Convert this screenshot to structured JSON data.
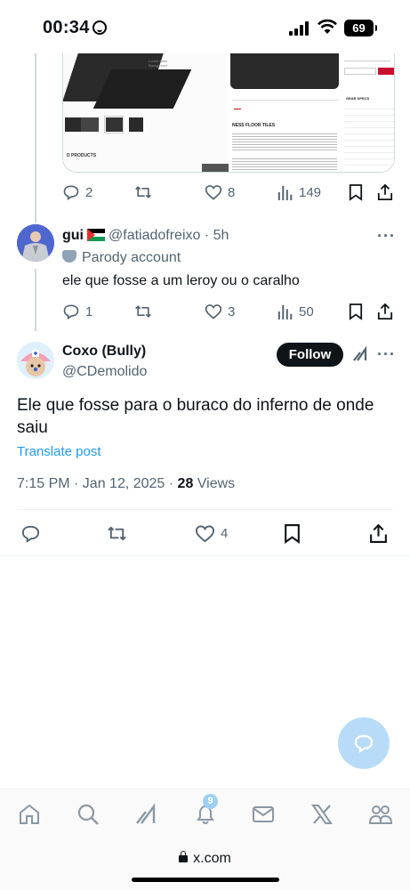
{
  "status_bar": {
    "time": "00:34",
    "battery": "69"
  },
  "previous_tweet_actions": {
    "replies": "2",
    "likes": "8",
    "views": "149"
  },
  "media_card": {
    "heading": "NESS FLOOR TILES",
    "specs_title": "GEAR SPECS",
    "specs": [
      {
        "k": "Brand",
        "v": "GravityRes"
      },
      {
        "k": "Color",
        "v": "Black"
      },
      {
        "k": "Made in USA",
        "v": "No"
      },
      {
        "k": "Product Weight",
        "v": "2.950 LBS"
      },
      {
        "k": "Length",
        "v": "500MM / 19.7"
      },
      {
        "k": "Width",
        "v": "500MM / 19.7"
      },
      {
        "k": "Height",
        "v": "15MM / 0.6"
      },
      {
        "k": "Other Product Specs",
        "v": "Made in EU"
      }
    ],
    "related": "D PRODUCTS"
  },
  "reply": {
    "name": "gui",
    "handle": "@fatiadofreixo",
    "time": "· 5h",
    "label": "Parody account",
    "text": "ele que fosse a um leroy ou o caralho",
    "replies": "1",
    "likes": "3",
    "views": "50"
  },
  "main_tweet": {
    "name": "Coxo (Bully)",
    "handle": "@CDemolido",
    "follow_label": "Follow",
    "text": "Ele que fosse para o buraco do inferno de onde saiu",
    "translate": "Translate post",
    "datetime": "7:15 PM · Jan 12, 2025 · ",
    "views_count": "28",
    "views_label": " Views",
    "likes": "4"
  },
  "bottom_nav": {
    "notifications_badge": "9"
  },
  "url_bar": {
    "url": "x.com"
  },
  "colors": {
    "accent": "#1d9bf0",
    "muted": "#536471",
    "fab": "#b8dcf7"
  }
}
